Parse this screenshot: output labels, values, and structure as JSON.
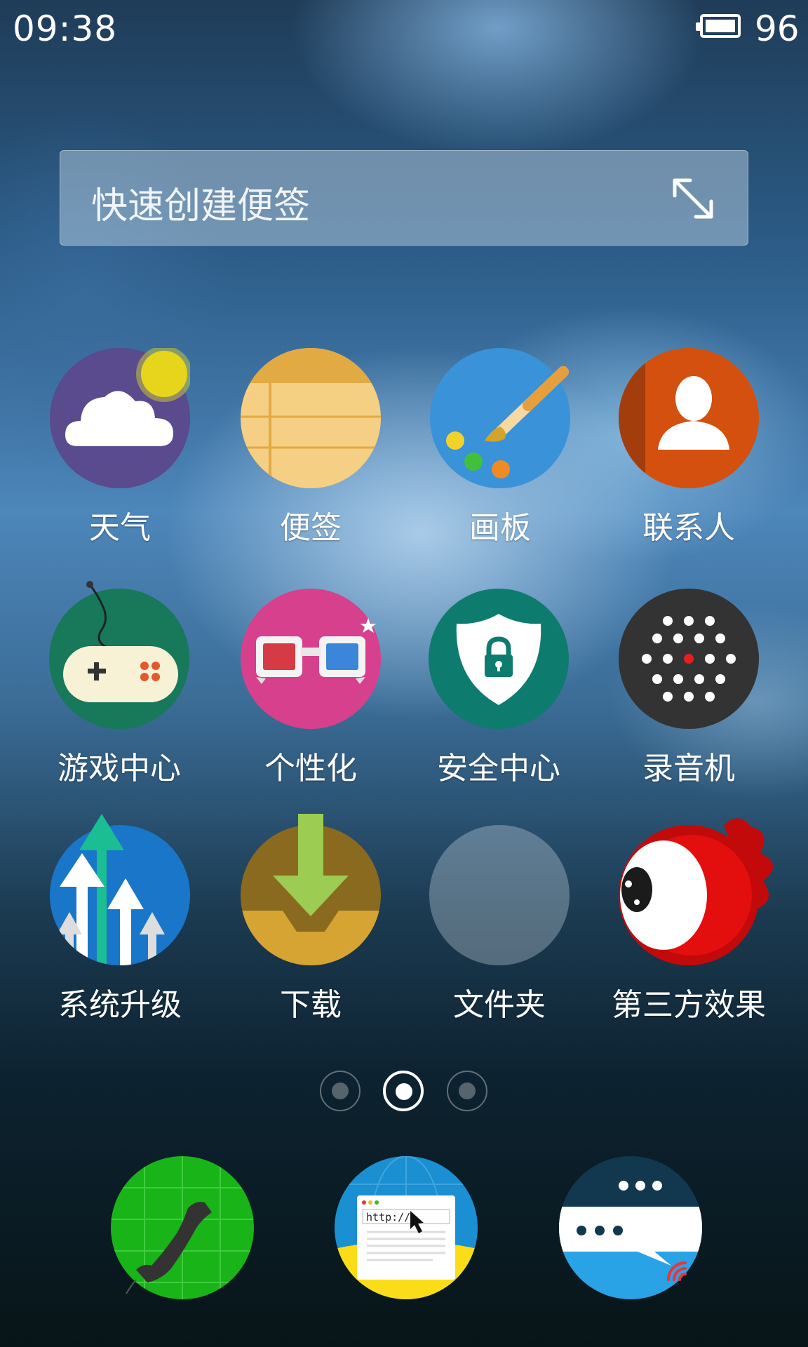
{
  "status_bar": {
    "time": "09:38",
    "battery": "96"
  },
  "note_widget": {
    "placeholder": "快速创建便签"
  },
  "apps": {
    "weather": "天气",
    "notes": "便签",
    "drawing": "画板",
    "contacts": "联系人",
    "game_center": "游戏中心",
    "personalization": "个性化",
    "security": "安全中心",
    "recorder": "录音机",
    "system_update": "系统升级",
    "download": "下载",
    "folder": "文件夹",
    "third_party_effects": "第三方效果"
  },
  "dock": {
    "browser_url_text": "http://"
  },
  "page_indicator": {
    "count": 3,
    "active_index": 2
  }
}
